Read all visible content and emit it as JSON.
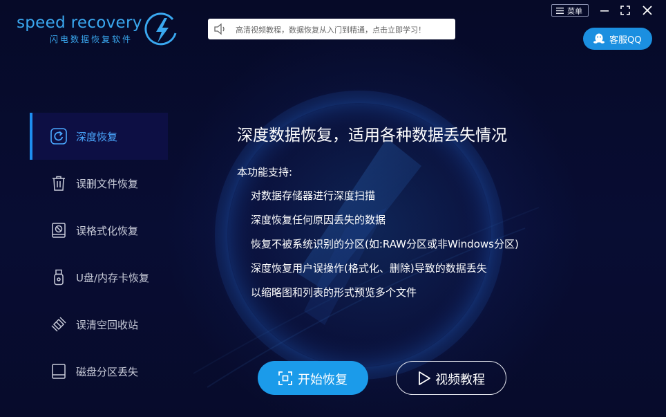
{
  "header": {
    "logo_text": "speed recovery",
    "logo_subtitle": "闪电数据恢复软件",
    "notice": "高清视频教程，数据恢复从入门到精通，点击立即学习！",
    "menu_label": "菜单",
    "qq_label": "客服QQ"
  },
  "sidebar": {
    "items": [
      {
        "label": "深度恢复",
        "icon": "deep-recovery-icon",
        "active": true
      },
      {
        "label": "误删文件恢复",
        "icon": "trash-icon",
        "active": false
      },
      {
        "label": "误格式化恢复",
        "icon": "format-disk-icon",
        "active": false
      },
      {
        "label": "U盘/内存卡恢复",
        "icon": "usb-drive-icon",
        "active": false
      },
      {
        "label": "误清空回收站",
        "icon": "recycle-bin-icon",
        "active": false
      },
      {
        "label": "磁盘分区丢失",
        "icon": "partition-icon",
        "active": false
      }
    ]
  },
  "content": {
    "title": "深度数据恢复，适用各种数据丢失情况",
    "support_label": "本功能支持:",
    "features": [
      "对数据存储器进行深度扫描",
      "深度恢复任何原因丢失的数据",
      "恢复不被系统识别的分区(如:RAW分区或非Windows分区)",
      "深度恢复用户误操作(格式化、删除)导致的数据丢失",
      "以缩略图和列表的形式预览多个文件"
    ]
  },
  "actions": {
    "start_label": "开始恢复",
    "video_label": "视频教程"
  },
  "colors": {
    "accent": "#1b9bea",
    "background": "#070b2b",
    "active_item_bg": "#0d0f44"
  }
}
